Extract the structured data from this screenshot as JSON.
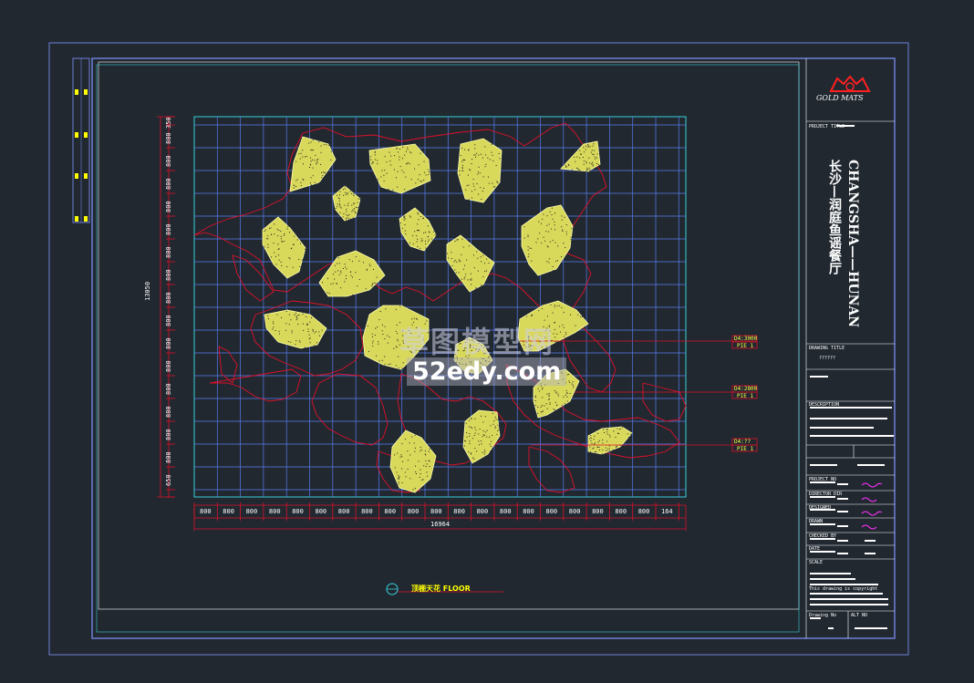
{
  "watermark": {
    "line1": "草图模型网",
    "line2": "52edy.com"
  },
  "plan": {
    "width_total": "16964",
    "height_total": "13050",
    "col_dims": [
      "800",
      "800",
      "800",
      "800",
      "800",
      "800",
      "800",
      "800",
      "800",
      "800",
      "800",
      "800",
      "800",
      "800",
      "800",
      "800",
      "800",
      "800",
      "800",
      "800",
      "164"
    ],
    "row_dims": [
      "350",
      "800",
      "800",
      "800",
      "800",
      "800",
      "800",
      "800",
      "800",
      "800",
      "800",
      "800",
      "800",
      "800",
      "800",
      "800",
      "650"
    ]
  },
  "tags": [
    {
      "top": "D4:3000",
      "bottom": "PIE 1"
    },
    {
      "top": "D4:2800",
      "bottom": "PIE 1"
    },
    {
      "top": "D4:??",
      "bottom": "PIE 1"
    }
  ],
  "title_block": {
    "logo_text": "GOLD MATS",
    "project_title_label": "PROJECT TITLE",
    "project_line1": "CHANGSHA——HUNAN",
    "project_line2": "长沙—润庭鱼谣餐厅",
    "drawing_title_label": "DRAWING TITLE",
    "drawing_title_value": "??????",
    "description_label": "DESCRIPTION",
    "designer_rows": [
      "PROJECT NO",
      "DIRECTOR DIR",
      "DESIGNED",
      "DRAWN",
      "CHECKED BY",
      "DATE",
      "SCALE"
    ],
    "copyright": "This drawing is copyright",
    "drawing_no_label": "Drawing No",
    "sheet_label": "ALT NO"
  },
  "colors": {
    "background": "#212830",
    "frame": "#6f7fd8",
    "grid": "#5a7cf0",
    "cyan": "#38d0d8",
    "red_outline": "#e0102a",
    "stone": "#e8e860"
  }
}
